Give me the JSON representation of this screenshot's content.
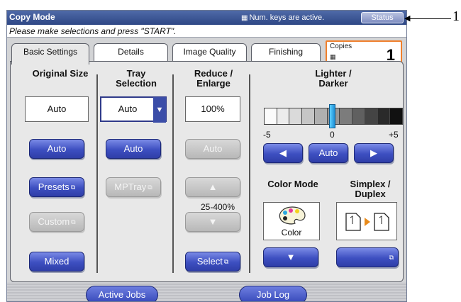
{
  "window": {
    "title": "Copy Mode",
    "numkeys_text": "Num. keys are active.",
    "status_label": "Status",
    "message": "Please make selections and press \"START\"."
  },
  "tabs": [
    {
      "label": "Basic Settings",
      "active": true
    },
    {
      "label": "Details",
      "active": false
    },
    {
      "label": "Image Quality",
      "active": false
    },
    {
      "label": "Finishing",
      "active": false
    }
  ],
  "copies": {
    "label": "Copies",
    "value": "1"
  },
  "original_size": {
    "heading": "Original Size",
    "value": "Auto",
    "buttons": [
      "Auto",
      "Presets",
      "Custom",
      "Mixed"
    ]
  },
  "tray_selection": {
    "heading_line1": "Tray",
    "heading_line2": "Selection",
    "value": "Auto",
    "buttons": [
      "Auto",
      "MPTray"
    ]
  },
  "reduce_enlarge": {
    "heading_line1": "Reduce /",
    "heading_line2": "Enlarge",
    "value": "100%",
    "auto_label": "Auto",
    "range": "25-400%",
    "select_label": "Select"
  },
  "density": {
    "heading_line1": "Lighter /",
    "heading_line2": "Darker",
    "min_label": "-5",
    "mid_label": "0",
    "max_label": "+5",
    "level": 0,
    "auto_label": "Auto"
  },
  "color_mode": {
    "heading": "Color Mode",
    "value": "Color"
  },
  "simplex": {
    "heading_line1": "Simplex /",
    "heading_line2": "Duplex"
  },
  "bottom": {
    "active_jobs": "Active Jobs",
    "job_log": "Job Log"
  },
  "callout": {
    "number": "1"
  },
  "colors": {
    "accent": "#3d4fc0",
    "title_bar": "#2e4785",
    "copies_border": "#f07f2c"
  }
}
